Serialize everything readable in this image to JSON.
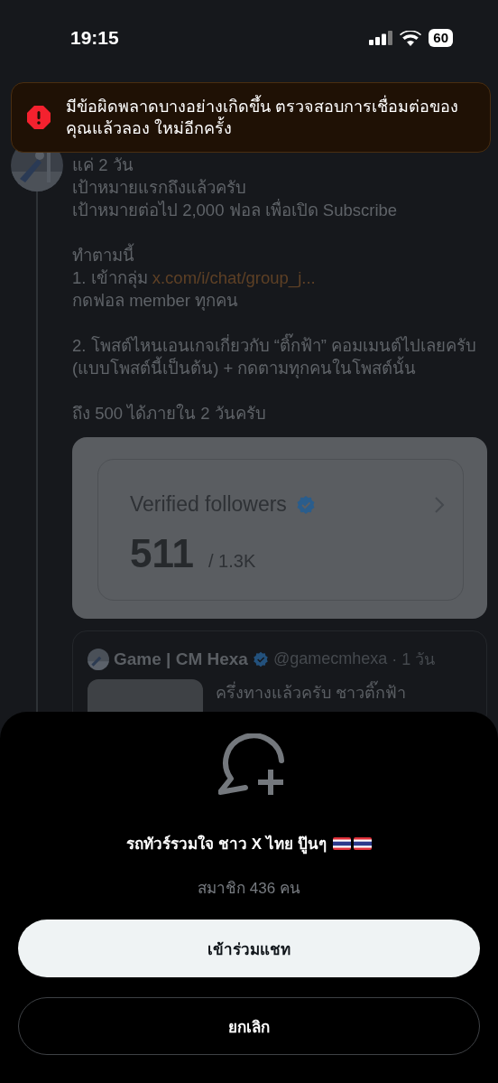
{
  "status_bar": {
    "time": "19:15",
    "battery": "60"
  },
  "error_toast": {
    "message": "มีข้อผิดพลาดบางอย่างเกิดขึ้น ตรวจสอบการเชื่อมต่อของคุณแล้วลอง ใหม่อีกครั้ง"
  },
  "post": {
    "lines": [
      {
        "kind": "text",
        "text": "แค่ 2 วัน"
      },
      {
        "kind": "text",
        "text": "เป้าหมายแรกถึงแล้วครับ"
      },
      {
        "kind": "text",
        "text": "เป้าหมายต่อไป 2,000 ฟอล เพื่อเปิด Subscribe"
      },
      {
        "kind": "blank"
      },
      {
        "kind": "text",
        "text": "ทำตามนี้"
      },
      {
        "kind": "link",
        "text": "1. เข้ากลุ่ม",
        "link": "x.com/i/chat/group_j..."
      },
      {
        "kind": "text",
        "text": "กดฟอล member ทุกคน"
      },
      {
        "kind": "blank"
      },
      {
        "kind": "text",
        "text": "2. โพสต์ไหนเอนเกจเกี่ยวกับ “ติ๊กฟ้า” คอมเมนต์ไปเลยครับ (แบบโพสต์นี้เป็นต้น) + กดตามทุกคนในโพสต์นั้น"
      },
      {
        "kind": "blank"
      },
      {
        "kind": "text",
        "text": "ถึง 500 ได้ภายใน 2 วันครับ"
      }
    ],
    "media": {
      "title": "Verified followers",
      "count": "511",
      "total": "/ 1.3K"
    },
    "quote": {
      "name": "Game | CM Hexa",
      "handle": "@gamecmhexa",
      "time": "· 1 วัน",
      "text": "ครึ่งทางแล้วครับ ชาวติ๊กฟ้า"
    }
  },
  "sheet": {
    "title": "รถทัวร์รวมใจ ชาว X ไทย ปู๊นๆ",
    "members": "สมาชิก 436 คน",
    "buttons": [
      {
        "kind": "primary",
        "label": "เข้าร่วมแชท"
      },
      {
        "kind": "secondary",
        "label": "ยกเลิก"
      }
    ]
  }
}
